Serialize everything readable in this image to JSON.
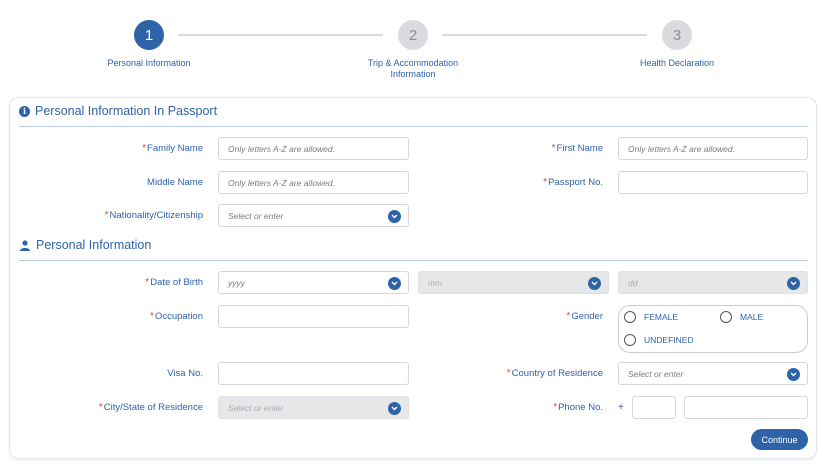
{
  "stepper": {
    "steps": [
      {
        "number": "1",
        "label": "Personal Information"
      },
      {
        "number": "2",
        "label": "Trip & Accommodation Information"
      },
      {
        "number": "3",
        "label": "Health Declaration"
      }
    ],
    "active_step": 1
  },
  "passport_section": {
    "title": "Personal Information In Passport",
    "family_name": {
      "label": "Family Name",
      "placeholder": "Only letters A-Z are allowed.",
      "required": true
    },
    "first_name": {
      "label": "First Name",
      "placeholder": "Only letters A-Z are allowed.",
      "required": true
    },
    "middle_name": {
      "label": "Middle Name",
      "placeholder": "Only letters A-Z are allowed.",
      "required": false
    },
    "passport_no": {
      "label": "Passport No.",
      "value": "",
      "required": true
    },
    "nationality": {
      "label": "Nationality/Citizenship",
      "placeholder": "Select or enter",
      "required": true
    }
  },
  "personal_section": {
    "title": "Personal Information",
    "date_of_birth": {
      "label": "Date of Birth",
      "year_placeholder": "yyyy",
      "month_placeholder": "mm",
      "day_placeholder": "dd",
      "required": true
    },
    "occupation": {
      "label": "Occupation",
      "value": "",
      "required": true
    },
    "gender": {
      "label": "Gender",
      "options": [
        "FEMALE",
        "MALE",
        "UNDEFINED"
      ],
      "selected": "",
      "required": true
    },
    "visa_no": {
      "label": "Visa No.",
      "value": "",
      "required": false
    },
    "country_of_residence": {
      "label": "Country of Residence",
      "placeholder": "Select or enter",
      "required": true
    },
    "city_state": {
      "label": "City/State of Residence",
      "placeholder": "Select or enter",
      "required": true
    },
    "phone": {
      "label": "Phone No.",
      "prefix": "+",
      "country_code": "",
      "number": "",
      "required": true
    }
  },
  "actions": {
    "continue_label": "Continue"
  },
  "colors": {
    "accent": "#2f63a8",
    "required": "#e2443a",
    "disabled": "#e6e7e9"
  },
  "icons": {
    "passport_section": "info-icon",
    "personal_section": "person-icon",
    "dropdown": "chevron-down-icon"
  }
}
